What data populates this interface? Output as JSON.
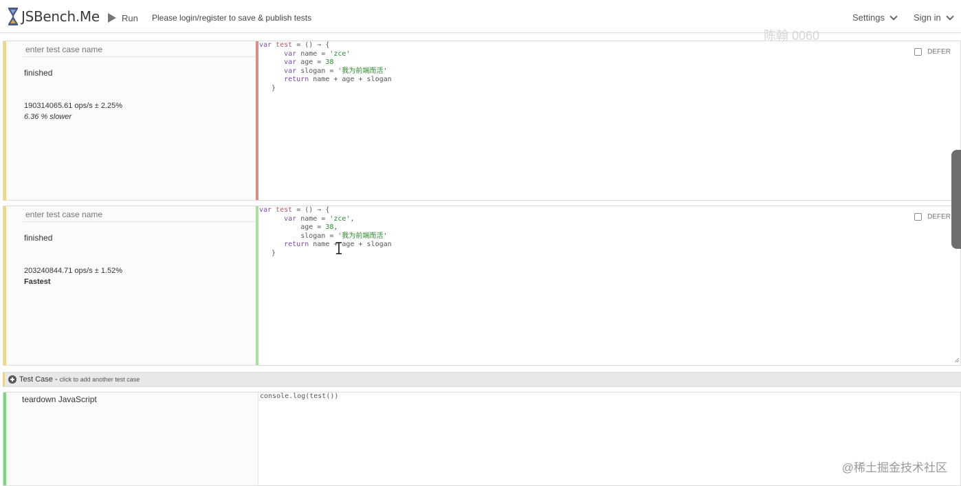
{
  "header": {
    "brand": "JSBench.Me",
    "run_label": "Run",
    "login_note": "Please login/register to save & publish tests",
    "settings_label": "Settings",
    "signin_label": "Sign in"
  },
  "watermark_name": "陈翰 0060",
  "test_cases": [
    {
      "name_placeholder": "enter test case name",
      "status": "finished",
      "ops": "190314065.61 ops/s ± 2.25%",
      "relative": "6.36 % slower",
      "defer_label": "DEFER",
      "defer_checked": false,
      "strip_color": "#f0d77a",
      "code_strip_color": "#e08a8a",
      "code_lines": [
        "var test = () ⇒ {",
        "      var name = 'zce'",
        "      var age = 38",
        "      var slogan = '我为前端而活'",
        "      return name + age + slogan",
        "   }"
      ]
    },
    {
      "name_placeholder": "enter test case name",
      "status": "finished",
      "ops": "203240844.71 ops/s ± 1.52%",
      "relative": "Fastest",
      "defer_label": "DEFER",
      "defer_checked": false,
      "strip_color": "#f0d77a",
      "code_strip_color": "#a8e0a0",
      "code_lines": [
        "var test = () ⇒ {",
        "      var name = 'zce',",
        "          age = 38,",
        "          slogan = '我为前端而活'",
        "      return name + age + slogan",
        "   }"
      ]
    }
  ],
  "add_bar": {
    "label": "Test Case -",
    "hint": "click to add another test case"
  },
  "teardown": {
    "label": "teardown JavaScript",
    "code": "console.log(test())"
  },
  "footer_watermark": "@稀土掘金技术社区",
  "colors": {
    "case_strip": "#f0d77a",
    "slower_code_strip": "#e08a8a",
    "fastest_code_strip": "#a8e0a0",
    "teardown_strip": "#7dd87d"
  },
  "icons": [
    "hourglass-logo-icon",
    "play-icon",
    "chevron-down-icon",
    "plus-circle-icon",
    "text-cursor-icon"
  ]
}
